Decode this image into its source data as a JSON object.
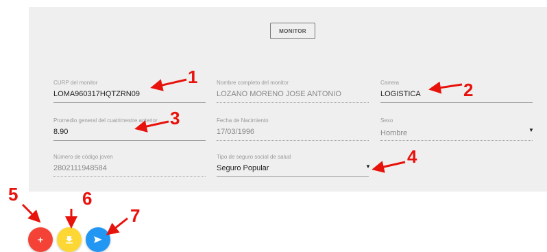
{
  "panel": {
    "monitor_button_label": "MONITOR"
  },
  "fields": {
    "curp": {
      "label": "CURP del monitor",
      "value": "LOMA960317HQTZRN09"
    },
    "nombre": {
      "label": "Nombre completo del monitor",
      "value": "LOZANO MORENO JOSE ANTONIO"
    },
    "carrera": {
      "label": "Carrera",
      "value": "LOGISTICA"
    },
    "promedio": {
      "label": "Promedio general del cuatrimestre anterior",
      "value": "8.90"
    },
    "fecha": {
      "label": "Fecha de Nacimiento",
      "value": "17/03/1996"
    },
    "sexo": {
      "label": "Sexo",
      "value": "Hombre"
    },
    "codigo_joven": {
      "label": "Número de código joven",
      "value": "2802111948584"
    },
    "seguro": {
      "label": "Tipo de seguro social de salud",
      "value": "Seguro Popular"
    }
  },
  "actions": {
    "add_label": "+",
    "download_icon": "download-icon",
    "send_icon": "send-icon"
  },
  "callouts": [
    "1",
    "2",
    "3",
    "4",
    "5",
    "6",
    "7"
  ],
  "colors": {
    "panel_bg": "#efefef",
    "callout_red": "#e8120c",
    "fab_red": "#f44336",
    "fab_yellow": "#fdd835",
    "fab_blue": "#2196f3"
  }
}
